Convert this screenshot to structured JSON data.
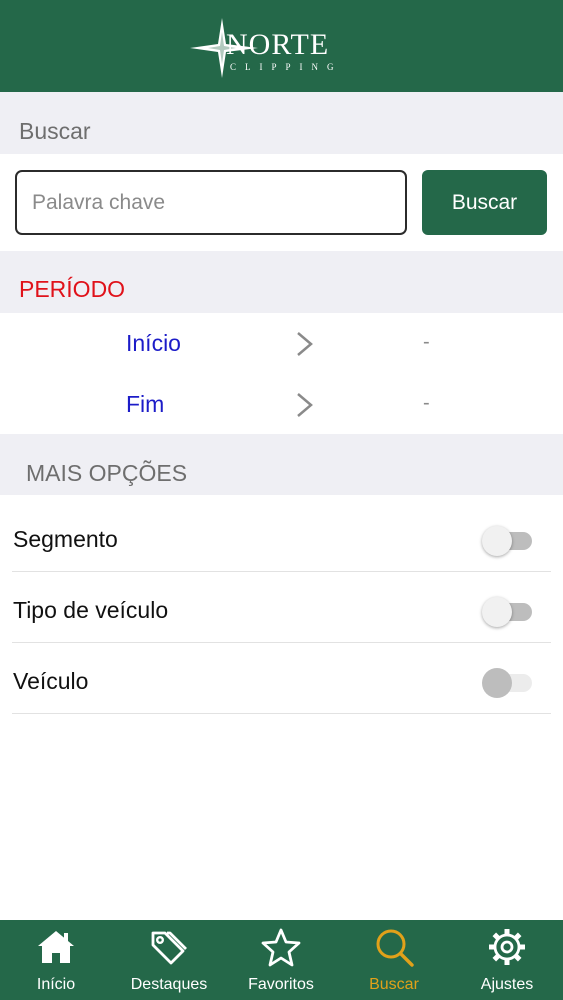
{
  "header": {
    "logo_title": "NORTE",
    "logo_subtitle": "CLIPPING"
  },
  "search": {
    "section_title": "Buscar",
    "placeholder": "Palavra chave",
    "value": "",
    "button_label": "Buscar"
  },
  "period": {
    "section_title": "PERÍODO",
    "rows": [
      {
        "label": "Início",
        "value": "-"
      },
      {
        "label": "Fim",
        "value": "-"
      }
    ]
  },
  "more_options": {
    "section_title": "MAIS OPÇÕES",
    "options": [
      {
        "label": "Segmento",
        "enabled": false
      },
      {
        "label": "Tipo de veículo",
        "enabled": false
      },
      {
        "label": "Veículo",
        "enabled": false
      }
    ]
  },
  "tabs": [
    {
      "label": "Início",
      "icon": "home-icon"
    },
    {
      "label": "Destaques",
      "icon": "tags-icon"
    },
    {
      "label": "Favoritos",
      "icon": "star-icon"
    },
    {
      "label": "Buscar",
      "icon": "search-icon",
      "active": true
    },
    {
      "label": "Ajustes",
      "icon": "gear-icon"
    }
  ],
  "colors": {
    "primary": "#246849",
    "accent": "#e1a11a",
    "period_title": "#e0121a",
    "period_label": "#1c1cc8",
    "section_bg": "#efeff4"
  }
}
